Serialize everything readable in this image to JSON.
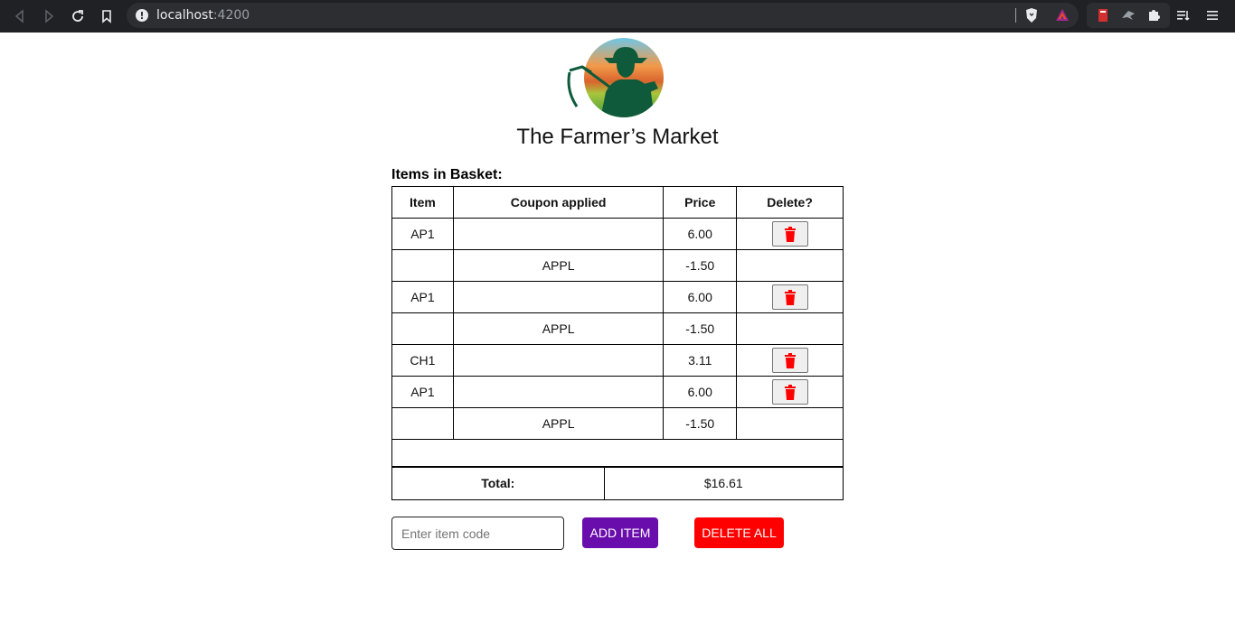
{
  "browser": {
    "url_host": "localhost",
    "url_port": ":4200"
  },
  "header": {
    "title": "The Farmer’s Market"
  },
  "basket": {
    "heading": "Items in Basket:",
    "columns": [
      "Item",
      "Coupon applied",
      "Price",
      "Delete?"
    ],
    "rows": [
      {
        "item": "AP1",
        "coupon": "",
        "price": "6.00",
        "deletable": true
      },
      {
        "item": "",
        "coupon": "APPL",
        "price": "-1.50",
        "deletable": false
      },
      {
        "item": "AP1",
        "coupon": "",
        "price": "6.00",
        "deletable": true
      },
      {
        "item": "",
        "coupon": "APPL",
        "price": "-1.50",
        "deletable": false
      },
      {
        "item": "CH1",
        "coupon": "",
        "price": "3.11",
        "deletable": true
      },
      {
        "item": "AP1",
        "coupon": "",
        "price": "6.00",
        "deletable": true
      },
      {
        "item": "",
        "coupon": "APPL",
        "price": "-1.50",
        "deletable": false
      }
    ],
    "total_label": "Total:",
    "total_value": "$16.61"
  },
  "controls": {
    "input_placeholder": "Enter item code",
    "input_value": "",
    "add_label": "ADD ITEM",
    "delete_all_label": "DELETE ALL"
  },
  "colors": {
    "add_button": "#6a0dad",
    "delete_all_button": "#ff0000",
    "trash_icon": "#ff0000"
  }
}
